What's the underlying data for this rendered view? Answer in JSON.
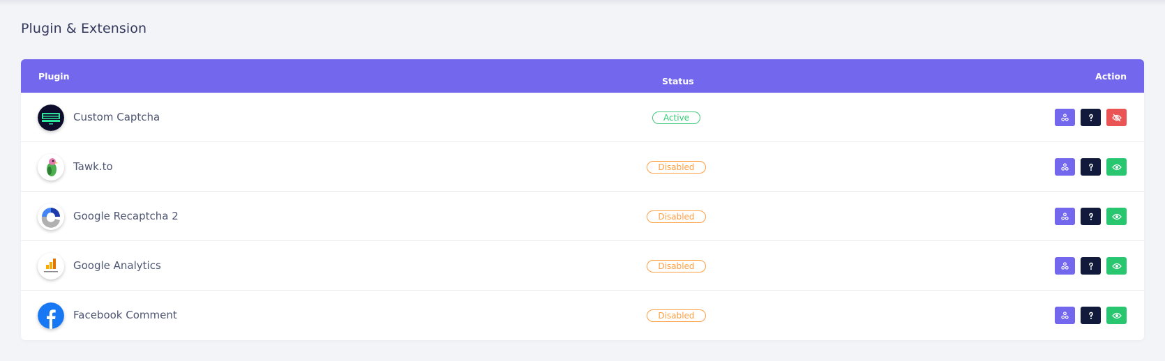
{
  "page": {
    "title": "Plugin & Extension"
  },
  "table": {
    "headers": {
      "plugin": "Plugin",
      "status": "Status",
      "action": "Action"
    },
    "rows": [
      {
        "name": "Custom Captcha",
        "status": "Active",
        "status_type": "active",
        "logo": "custom-captcha-logo",
        "toggle": "hide-eye-icon"
      },
      {
        "name": "Tawk.to",
        "status": "Disabled",
        "status_type": "disabled",
        "logo": "tawkto-parrot-logo",
        "toggle": "eye-icon"
      },
      {
        "name": "Google Recaptcha 2",
        "status": "Disabled",
        "status_type": "disabled",
        "logo": "google-recaptcha-logo",
        "toggle": "eye-icon"
      },
      {
        "name": "Google Analytics",
        "status": "Disabled",
        "status_type": "disabled",
        "logo": "google-analytics-logo",
        "toggle": "eye-icon"
      },
      {
        "name": "Facebook Comment",
        "status": "Disabled",
        "status_type": "disabled",
        "logo": "facebook-logo",
        "toggle": "eye-icon"
      }
    ]
  },
  "colors": {
    "header_bg": "#7367ed",
    "active": "#28c76f",
    "disabled": "#ff9f43",
    "danger": "#ea5455",
    "dark": "#111a3b"
  }
}
